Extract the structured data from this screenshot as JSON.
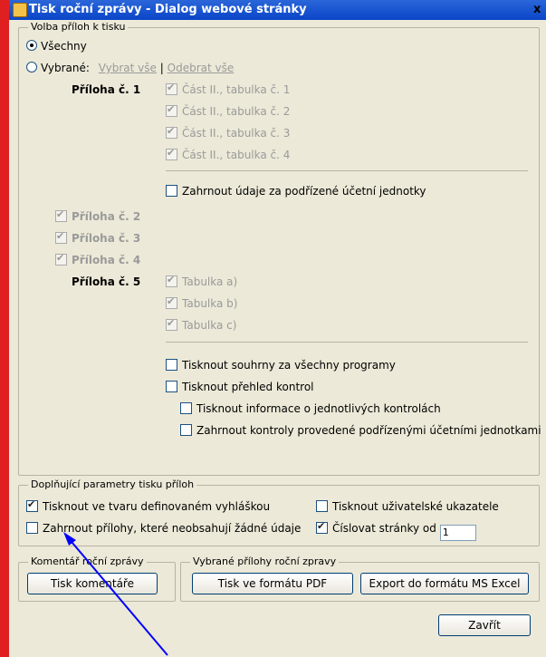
{
  "title": "Tisk roční zprávy - Dialog webové stránky",
  "close_glyph": "x",
  "attachments": {
    "legend": "Volba příloh k tisku",
    "radio_all": "Všechny",
    "radio_selected": "Vybrané:",
    "select_all": "Vybrat vše",
    "separator": "|",
    "deselect_all": "Odebrat vše",
    "priloha1": {
      "label": "Příloha č. 1",
      "items": [
        "Část II., tabulka č. 1",
        "Část II., tabulka č. 2",
        "Část II., tabulka č. 3",
        "Část II., tabulka č. 4"
      ],
      "include_sub": "Zahrnout údaje za podřízené účetní jednotky"
    },
    "priloha2": "Příloha č. 2",
    "priloha3": "Příloha č. 3",
    "priloha4": "Příloha č. 4",
    "priloha5": {
      "label": "Příloha č. 5",
      "items": [
        "Tabulka a)",
        "Tabulka b)",
        "Tabulka c)"
      ],
      "print_summaries": "Tisknout souhrny za všechny programy",
      "print_overview": "Tisknout přehled kontrol",
      "print_info": "Tisknout informace o jednotlivých kontrolách",
      "include_controls": "Zahrnout kontroly provedené podřízenými účetními jednotkami"
    }
  },
  "params": {
    "legend": "Doplňující parametry tisku příloh",
    "print_defined": "Tisknout ve tvaru definovaném vyhláškou",
    "print_user": "Tisknout uživatelské ukazatele",
    "include_empty": "Zahrnout přílohy, které neobsahují žádné údaje",
    "number_pages": "Číslovat stránky od",
    "page_start": "1"
  },
  "comment": {
    "legend": "Komentář roční zprávy",
    "button": "Tisk komentáře"
  },
  "selected": {
    "legend": "Vybrané přílohy roční zpravy",
    "pdf_button": "Tisk ve formátu PDF",
    "excel_button": "Export do formátu MS Excel"
  },
  "close_button": "Zavřít",
  "annotation_color": "#0000ff"
}
